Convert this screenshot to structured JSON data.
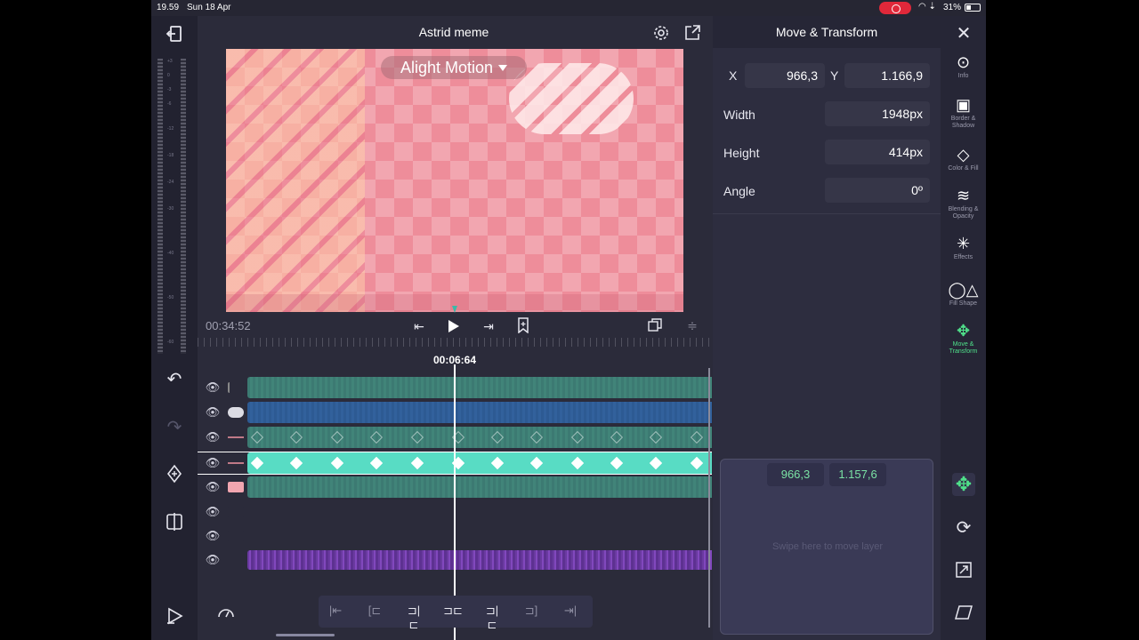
{
  "status": {
    "time": "19.59",
    "date": "Sun 18 Apr",
    "battery": "31%"
  },
  "project": {
    "title": "Astrid meme"
  },
  "preview": {
    "watermark": "Alight Motion"
  },
  "transport": {
    "duration": "00:34:52",
    "current_time": "00:06:64"
  },
  "panel": {
    "title": "Move & Transform",
    "x_label": "X",
    "x_value": "966,3",
    "y_label": "Y",
    "y_value": "1.166,9",
    "width_label": "Width",
    "width_value": "1948px",
    "height_label": "Height",
    "height_value": "414px",
    "angle_label": "Angle",
    "angle_value": "0º",
    "swipe_x": "966,3",
    "swipe_y": "1.157,6",
    "swipe_hint": "Swipe here to move layer"
  },
  "rail": [
    {
      "label": "Info",
      "icon": "more-icon"
    },
    {
      "label": "Border & Shadow",
      "icon": "border-icon"
    },
    {
      "label": "Color & Fill",
      "icon": "fill-icon"
    },
    {
      "label": "Blending & Opacity",
      "icon": "blending-icon"
    },
    {
      "label": "Effects",
      "icon": "effects-icon"
    },
    {
      "label": "Fill Shape",
      "icon": "shapes-icon"
    },
    {
      "label": "Move & Transform",
      "icon": "move-icon"
    }
  ],
  "colors": {
    "accent": "#4fe08a",
    "active_track": "#58dcc4",
    "canvas": "#f2a6b0"
  }
}
